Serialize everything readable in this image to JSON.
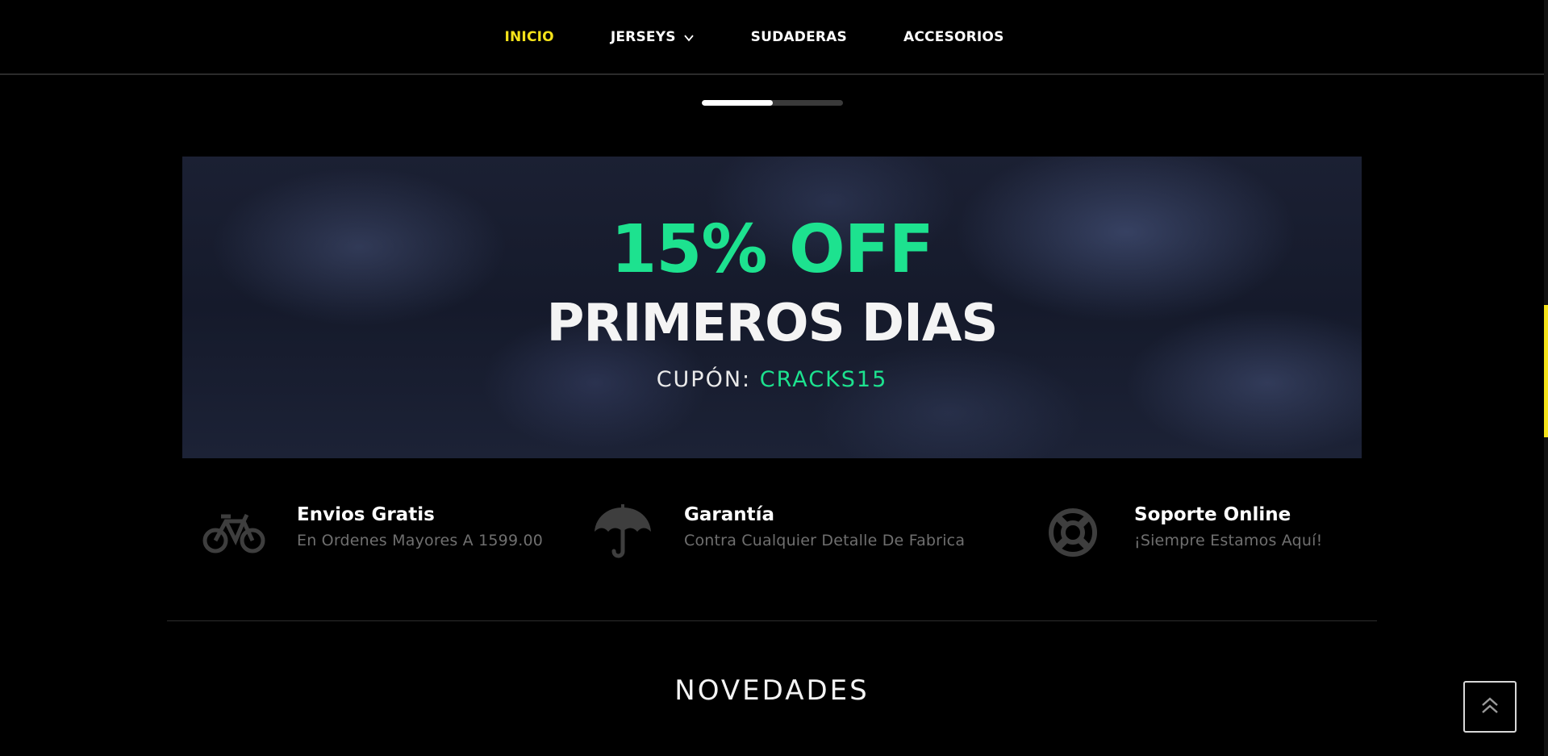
{
  "nav": {
    "items": [
      {
        "label": "INICIO",
        "active": true
      },
      {
        "label": "JERSEYS",
        "has_dropdown": true
      },
      {
        "label": "SUDADERAS"
      },
      {
        "label": "ACCESORIOS"
      }
    ],
    "active_color": "#f4e21a"
  },
  "slider": {
    "progress": 0.5
  },
  "banner": {
    "line1": "15% OFF",
    "line2": "PRIMEROS DIAS",
    "coupon_label": "CUPÓN: ",
    "coupon_code": "CRACKS15",
    "accent_color": "#1de28f"
  },
  "features": [
    {
      "icon": "bicycle-icon",
      "title": "Envios Gratis",
      "subtitle": "En Ordenes Mayores A 1599.00"
    },
    {
      "icon": "umbrella-icon",
      "title": "Garantía",
      "subtitle": "Contra Cualquier Detalle De Fabrica"
    },
    {
      "icon": "life-ring-icon",
      "title": "Soporte Online",
      "subtitle": "¡Siempre Estamos Aquí!"
    }
  ],
  "section": {
    "title": "NOVEDADES"
  },
  "back_to_top": {
    "icon": "double-chevron-up-icon"
  }
}
